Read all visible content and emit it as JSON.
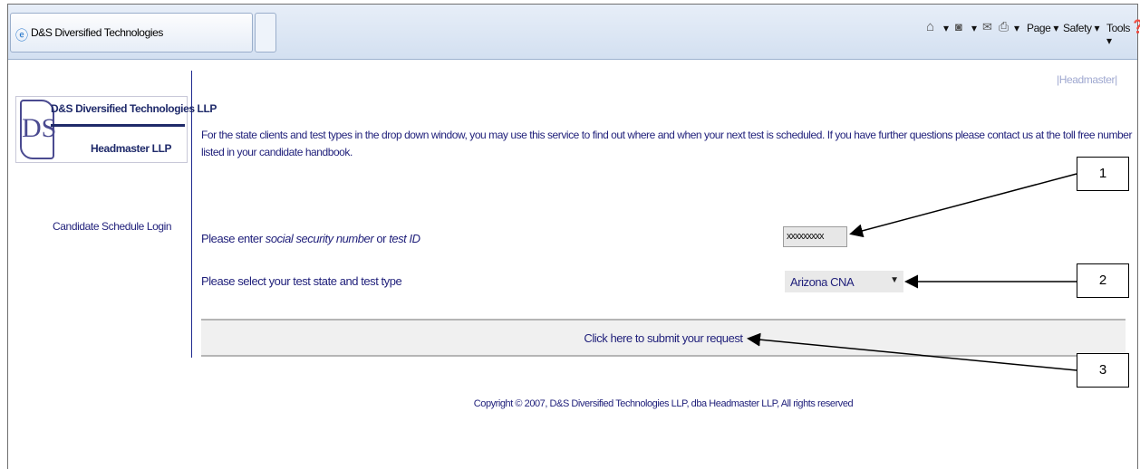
{
  "browser": {
    "tab_title": "D&S Diversified Technologies",
    "commands": {
      "page": "Page ▾",
      "safety": "Safety ▾",
      "tools": "Tools ▾"
    },
    "icons": [
      "ie-icon",
      "home-icon",
      "rss-icon",
      "mail-icon",
      "print-icon",
      "help-icon"
    ]
  },
  "sidebar": {
    "logo_line1": "D&S Diversified Technologies LLP",
    "logo_line2": "Headmaster LLP",
    "logo_mark": "DS",
    "link": "Candidate Schedule Login"
  },
  "main": {
    "top_link": "|Headmaster|",
    "intro": "For the state clients and test types in the drop down window, you may use this service to find out where and when your next test is scheduled. If you have further questions please contact us at the toll free number listed in your candidate handbook.",
    "ssn_label_prefix": "Please enter ",
    "ssn_label_em1": "social security number",
    "ssn_label_mid": " or ",
    "ssn_label_em2": "test ID",
    "ssn_value": "xxxxxxxxx",
    "state_label": "Please select your test state and test type",
    "state_value": "Arizona CNA",
    "submit_label": "Click here to submit your request",
    "copyright": "Copyright © 2007, D&S Diversified Technologies LLP, dba Headmaster LLP, All rights reserved"
  },
  "callouts": [
    "1",
    "2",
    "3"
  ]
}
